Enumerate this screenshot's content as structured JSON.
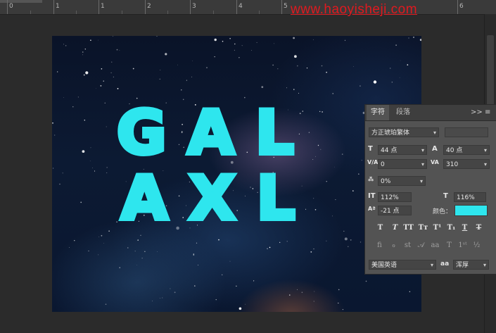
{
  "ruler": {
    "numbers": [
      "0",
      "1",
      "1",
      "2",
      "3",
      "4",
      "5",
      "6"
    ]
  },
  "watermark": "www.haoyisheji.com",
  "canvas": {
    "text_line1": "G A L",
    "text_line2": "A X L",
    "text_color": "#2ee6ee"
  },
  "character_panel": {
    "tab_character": "字符",
    "tab_paragraph": "段落",
    "collapse_icon": ">>",
    "menu_icon": "≡",
    "font_family": "方正琥珀繁体",
    "font_size": "44 点",
    "leading": "40 点",
    "kerning": "0",
    "tracking": "310",
    "scale_proportion": "0%",
    "vertical_scale": "112%",
    "horizontal_scale": "116%",
    "baseline_shift": "-21 点",
    "color_label": "颜色：",
    "color_value": "#2ee6ee",
    "language": "美国英语",
    "anti_alias_label": "aa",
    "anti_alias": "浑厚"
  }
}
